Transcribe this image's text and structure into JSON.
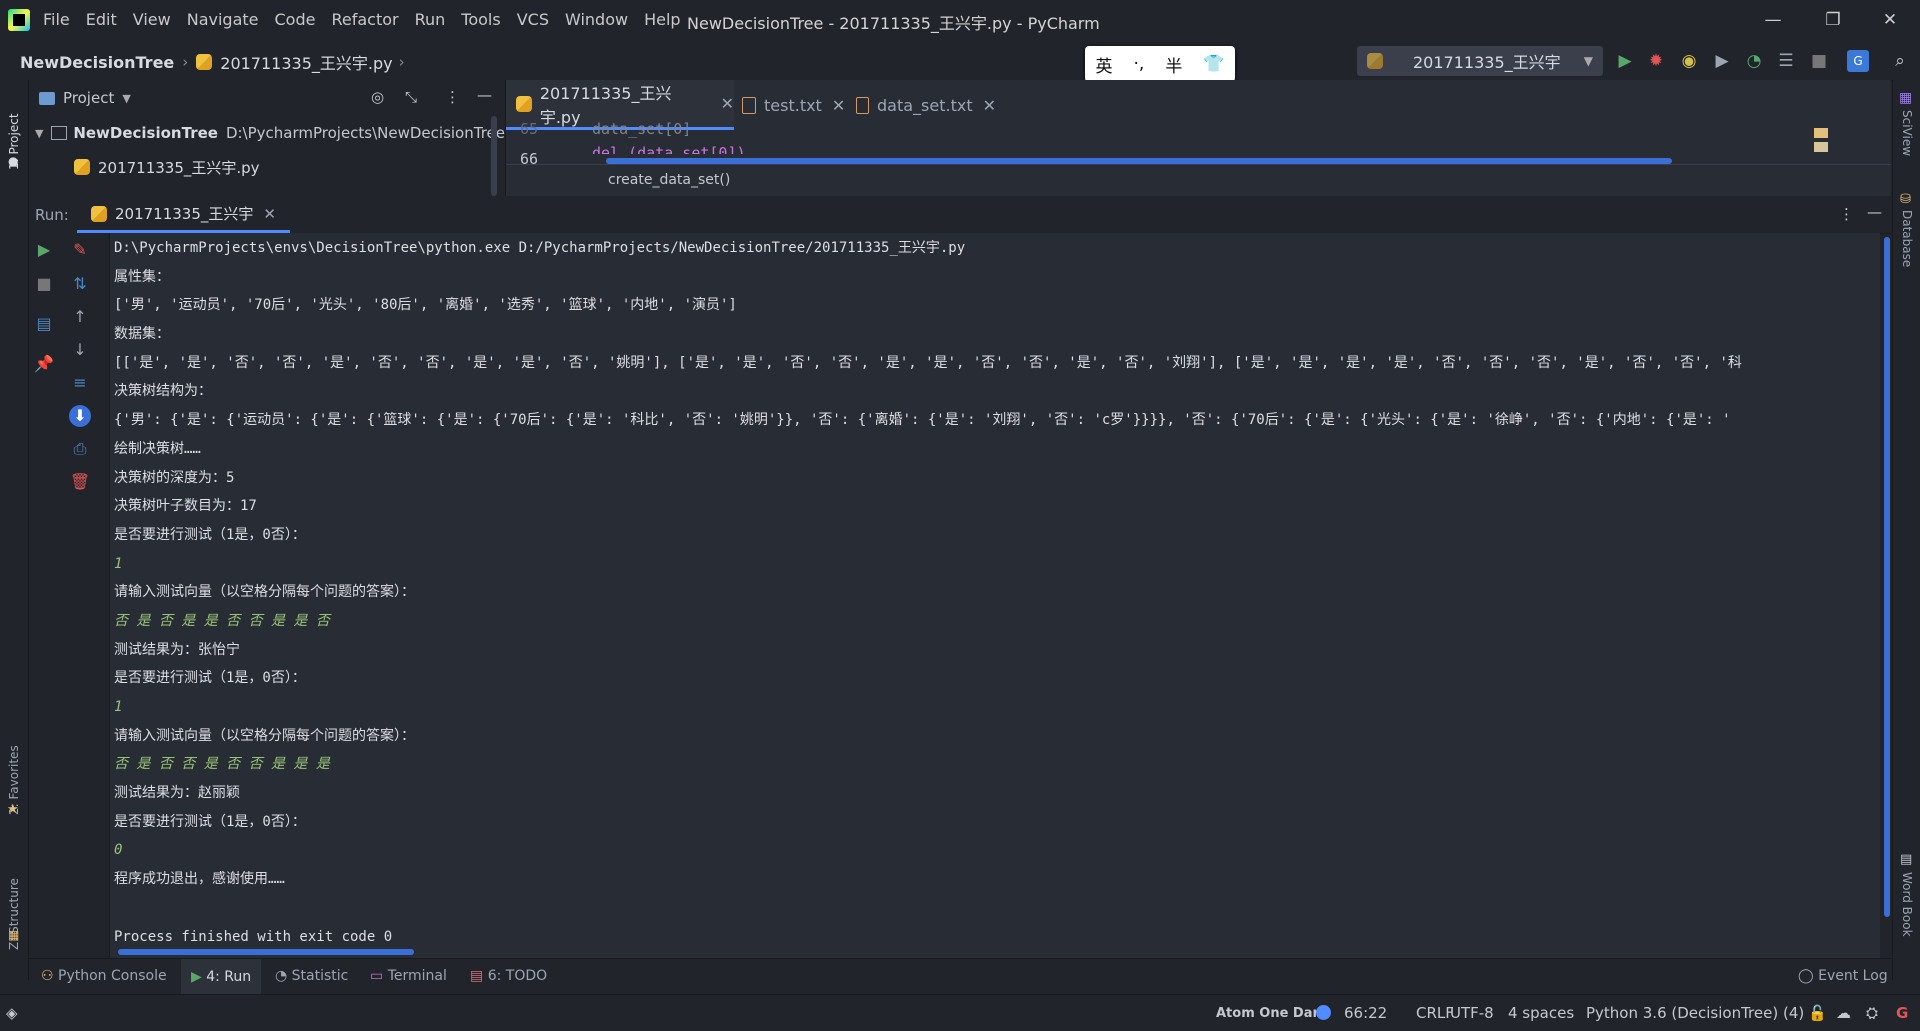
{
  "menu": [
    "File",
    "Edit",
    "View",
    "Navigate",
    "Code",
    "Refactor",
    "Run",
    "Tools",
    "VCS",
    "Window",
    "Help"
  ],
  "window_title": "NewDecisionTree - 201711335_王兴宇.py - PyCharm",
  "breadcrumb": {
    "project": "NewDecisionTree",
    "file": "201711335_王兴宇.py"
  },
  "ime": {
    "lang": "英",
    "punct": "·,",
    "width": "半",
    "skin": "👕"
  },
  "run_config": "201711335_王兴宇",
  "project_panel": {
    "title": "Project",
    "root_name": "NewDecisionTree",
    "root_path": "D:\\PycharmProjects\\NewDecisionTree",
    "file": "201711335_王兴宇.py"
  },
  "editor": {
    "tabs": [
      "201711335_王兴宇.py",
      "test.txt",
      "data_set.txt"
    ],
    "line_numbers": [
      "65",
      "66"
    ],
    "code_lines": [
      "data_set[0]",
      "del (data_set[0])"
    ],
    "breadcrumb": "create_data_set()"
  },
  "run": {
    "label": "Run:",
    "tab": "201711335_王兴宇",
    "output": [
      {
        "text": "D:\\PycharmProjects\\envs\\DecisionTree\\python.exe D:/PycharmProjects/NewDecisionTree/201711335_王兴宇.py",
        "kind": "path"
      },
      {
        "text": "属性集：",
        "kind": "out"
      },
      {
        "text": "['男', '运动员', '70后', '光头', '80后', '离婚', '选秀', '篮球', '内地', '演员']",
        "kind": "out"
      },
      {
        "text": "数据集：",
        "kind": "out"
      },
      {
        "text": "[['是', '是', '否', '否', '是', '否', '否', '是', '是', '否', '姚明'], ['是', '是', '否', '否', '是', '是', '否', '否', '是', '否', '刘翔'], ['是', '是', '是', '是', '否', '否', '否', '是', '否', '否', '科",
        "kind": "out"
      },
      {
        "text": "决策树结构为：",
        "kind": "out"
      },
      {
        "text": "{'男': {'是': {'运动员': {'是': {'篮球': {'是': {'70后': {'是': '科比', '否': '姚明'}}, '否': {'离婚': {'是': '刘翔', '否': 'c罗'}}}}, '否': {'70后': {'是': {'光头': {'是': '徐峥', '否': {'内地': {'是': '",
        "kind": "out"
      },
      {
        "text": "绘制决策树……",
        "kind": "out"
      },
      {
        "text": "决策树的深度为：5",
        "kind": "out"
      },
      {
        "text": "决策树叶子数目为：17",
        "kind": "out"
      },
      {
        "text": "是否要进行测试（1是，0否）：",
        "kind": "out"
      },
      {
        "text": "1",
        "kind": "input"
      },
      {
        "text": "请输入测试向量（以空格分隔每个问题的答案）：",
        "kind": "out"
      },
      {
        "text": "否 是 否 是 是 否 否 是 是 否",
        "kind": "input"
      },
      {
        "text": "测试结果为：张怡宁",
        "kind": "out"
      },
      {
        "text": "是否要进行测试（1是，0否）：",
        "kind": "out"
      },
      {
        "text": "1",
        "kind": "input"
      },
      {
        "text": "请输入测试向量（以空格分隔每个问题的答案）：",
        "kind": "out"
      },
      {
        "text": "否 是 否 否 是 否 否 是 是 是",
        "kind": "input"
      },
      {
        "text": "测试结果为：赵丽颖",
        "kind": "out"
      },
      {
        "text": "是否要进行测试（1是，0否）：",
        "kind": "out"
      },
      {
        "text": "0",
        "kind": "input"
      },
      {
        "text": "程序成功退出，感谢使用……",
        "kind": "out"
      },
      {
        "text": "",
        "kind": "out"
      },
      {
        "text": "Process finished with exit code 0",
        "kind": "out"
      }
    ]
  },
  "left_stripe": {
    "project": "1: Project",
    "favorites": "2: Favorites",
    "structure": "Z: Structure"
  },
  "right_stripe": {
    "sciview": "SciView",
    "database": "Database",
    "wordbook": "Word Book"
  },
  "bottom_tabs": [
    "Python Console",
    "4: Run",
    "Statistic",
    "Terminal",
    "6: TODO"
  ],
  "event_log": "Event Log",
  "status": {
    "theme": "Atom One Dark",
    "position": "66:22",
    "line_sep": "CRLF",
    "encoding": "UTF-8",
    "indent": "4 spaces",
    "interpreter": "Python 3.6 (DecisionTree) (4)"
  },
  "colors": {
    "accent": "#528bff",
    "run_green": "#59a869",
    "debug_red": "#e05555"
  }
}
